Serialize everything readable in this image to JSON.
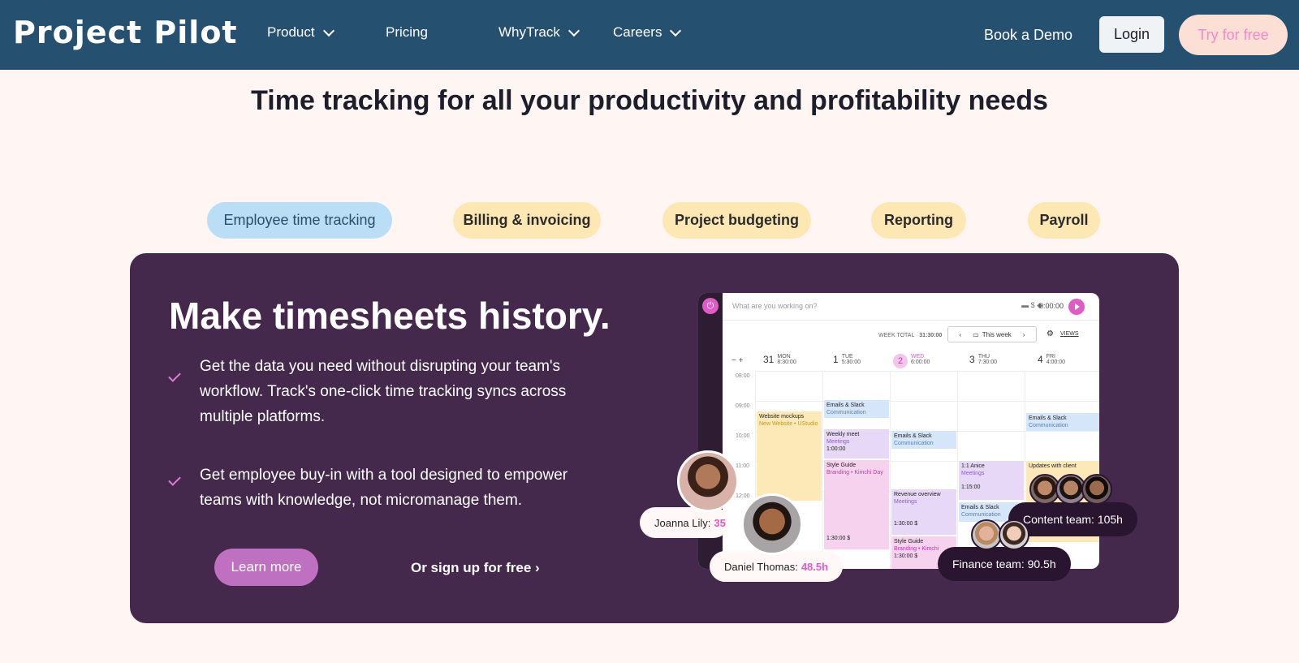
{
  "nav": {
    "logo": "Project Pilot",
    "items": [
      {
        "label": "Product",
        "dropdown": true
      },
      {
        "label": "Pricing",
        "dropdown": false
      },
      {
        "label": "WhyTrack",
        "dropdown": true
      },
      {
        "label": "Careers",
        "dropdown": true
      }
    ],
    "book_demo": "Book a Demo",
    "login": "Login",
    "try_free": "Try for free"
  },
  "headline": "Time tracking for all your productivity and profitability needs",
  "tabs": [
    {
      "label": "Employee time tracking",
      "active": true
    },
    {
      "label": "Billing & invoicing",
      "active": false
    },
    {
      "label": "Project budgeting",
      "active": false
    },
    {
      "label": "Reporting",
      "active": false
    },
    {
      "label": "Payroll",
      "active": false
    }
  ],
  "panel": {
    "title": "Make timesheets history.",
    "bullets": [
      "Get the data you need without disrupting your team's workflow. Track's one-click time tracking syncs across multiple platforms.",
      "Get employee buy-in with a tool designed to empower teams with knowledge, not micromanage them."
    ],
    "learn_more": "Learn more",
    "signup": "Or sign up for free ›"
  },
  "app": {
    "search_placeholder": "What are you working on?",
    "timer": "0:00:00",
    "week_total_label": "WEEK TOTAL",
    "week_total": "31:30:00",
    "week_button": "This week",
    "views": "VIEWS",
    "days": [
      {
        "num": "31",
        "name": "MON",
        "total": "8:30:00"
      },
      {
        "num": "1",
        "name": "TUE",
        "total": "5:30:00"
      },
      {
        "num": "2",
        "name": "WED",
        "total": "6:00:00"
      },
      {
        "num": "3",
        "name": "THU",
        "total": "7:30:00"
      },
      {
        "num": "4",
        "name": "FRI",
        "total": "4:00:00"
      }
    ],
    "hours": [
      "08:00",
      "09:00",
      "10:00",
      "11:00",
      "12:00"
    ],
    "events": {
      "mon_1_title": "Website mockups",
      "mon_1_sub": "New Website • UStudio",
      "tue_1_title": "Emails & Slack",
      "tue_1_sub": "Communication",
      "tue_2_title": "Weekly meet",
      "tue_2_sub": "Meetings",
      "tue_2_time": "1:00:00",
      "tue_3_title": "Style Guide",
      "tue_3_sub": "Branding • Kimchi Day",
      "tue_3_time": "1:30:00 $",
      "wed_1_title": "Emails & Slack",
      "wed_1_sub": "Communication",
      "wed_2_title": "Revenue overview",
      "wed_2_sub": "Meetings",
      "wed_2_time": "1:30:00 $",
      "wed_3_title": "Style Guide",
      "wed_3_sub": "Branding • Kimchi",
      "wed_3_time": "1:30:00 $",
      "thu_1_title": "1:1 Anice",
      "thu_1_sub": "Meetings",
      "thu_1_time": "1:15:00",
      "thu_2_title": "Emails & Slack",
      "thu_2_sub": "Communication",
      "fri_1_title": "Emails & Slack",
      "fri_1_sub": "Communication",
      "fri_2_title": "Updates with client"
    }
  },
  "badges": {
    "joanna": {
      "name": "Joanna Lily:",
      "hours": "35"
    },
    "daniel": {
      "name": "Daniel Thomas:",
      "hours": "48.5h"
    },
    "content": "Content team: 105h",
    "finance": "Finance team: 90.5h"
  },
  "colors": {
    "nav_bg": "#26506f",
    "page_bg": "#fff6f3",
    "panel_bg": "#44294d",
    "accent_pink": "#e05bc5",
    "tab_bg": "#fde8b3",
    "tab_active_bg": "#b9def6"
  }
}
